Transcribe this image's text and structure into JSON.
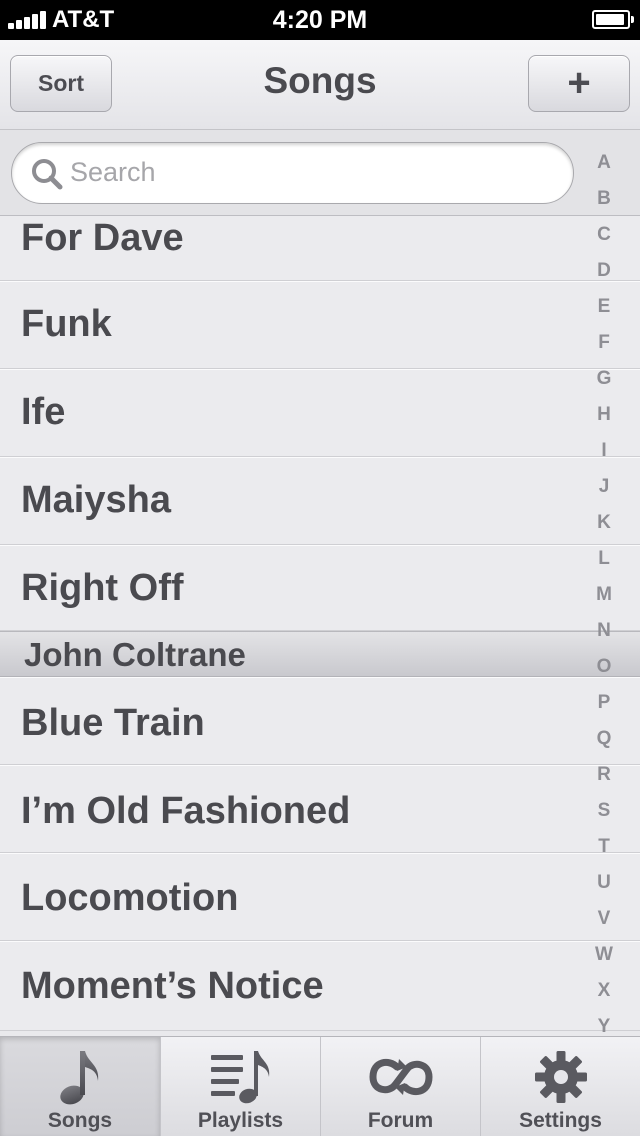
{
  "status_bar": {
    "carrier": "AT&T",
    "time": "4:20 PM"
  },
  "nav": {
    "title": "Songs",
    "sort_label": "Sort",
    "add_label": "+"
  },
  "search": {
    "placeholder": "Search"
  },
  "list": {
    "items": [
      "For Dave",
      "Funk",
      "Ife",
      "Maiysha",
      "Right Off",
      "John Coltrane",
      "Blue Train",
      "I’m Old Fashioned",
      "Locomotion",
      "Moment’s Notice"
    ]
  },
  "index_letters": [
    "A",
    "B",
    "C",
    "D",
    "E",
    "F",
    "G",
    "H",
    "I",
    "J",
    "K",
    "L",
    "M",
    "N",
    "O",
    "P",
    "Q",
    "R",
    "S",
    "T",
    "U",
    "V",
    "W",
    "X",
    "Y"
  ],
  "tabs": [
    {
      "label": "Songs",
      "icon": "music-note-icon",
      "active": true
    },
    {
      "label": "Playlists",
      "icon": "playlist-icon",
      "active": false
    },
    {
      "label": "Forum",
      "icon": "forum-icon",
      "active": false
    },
    {
      "label": "Settings",
      "icon": "gear-icon",
      "active": false
    }
  ]
}
